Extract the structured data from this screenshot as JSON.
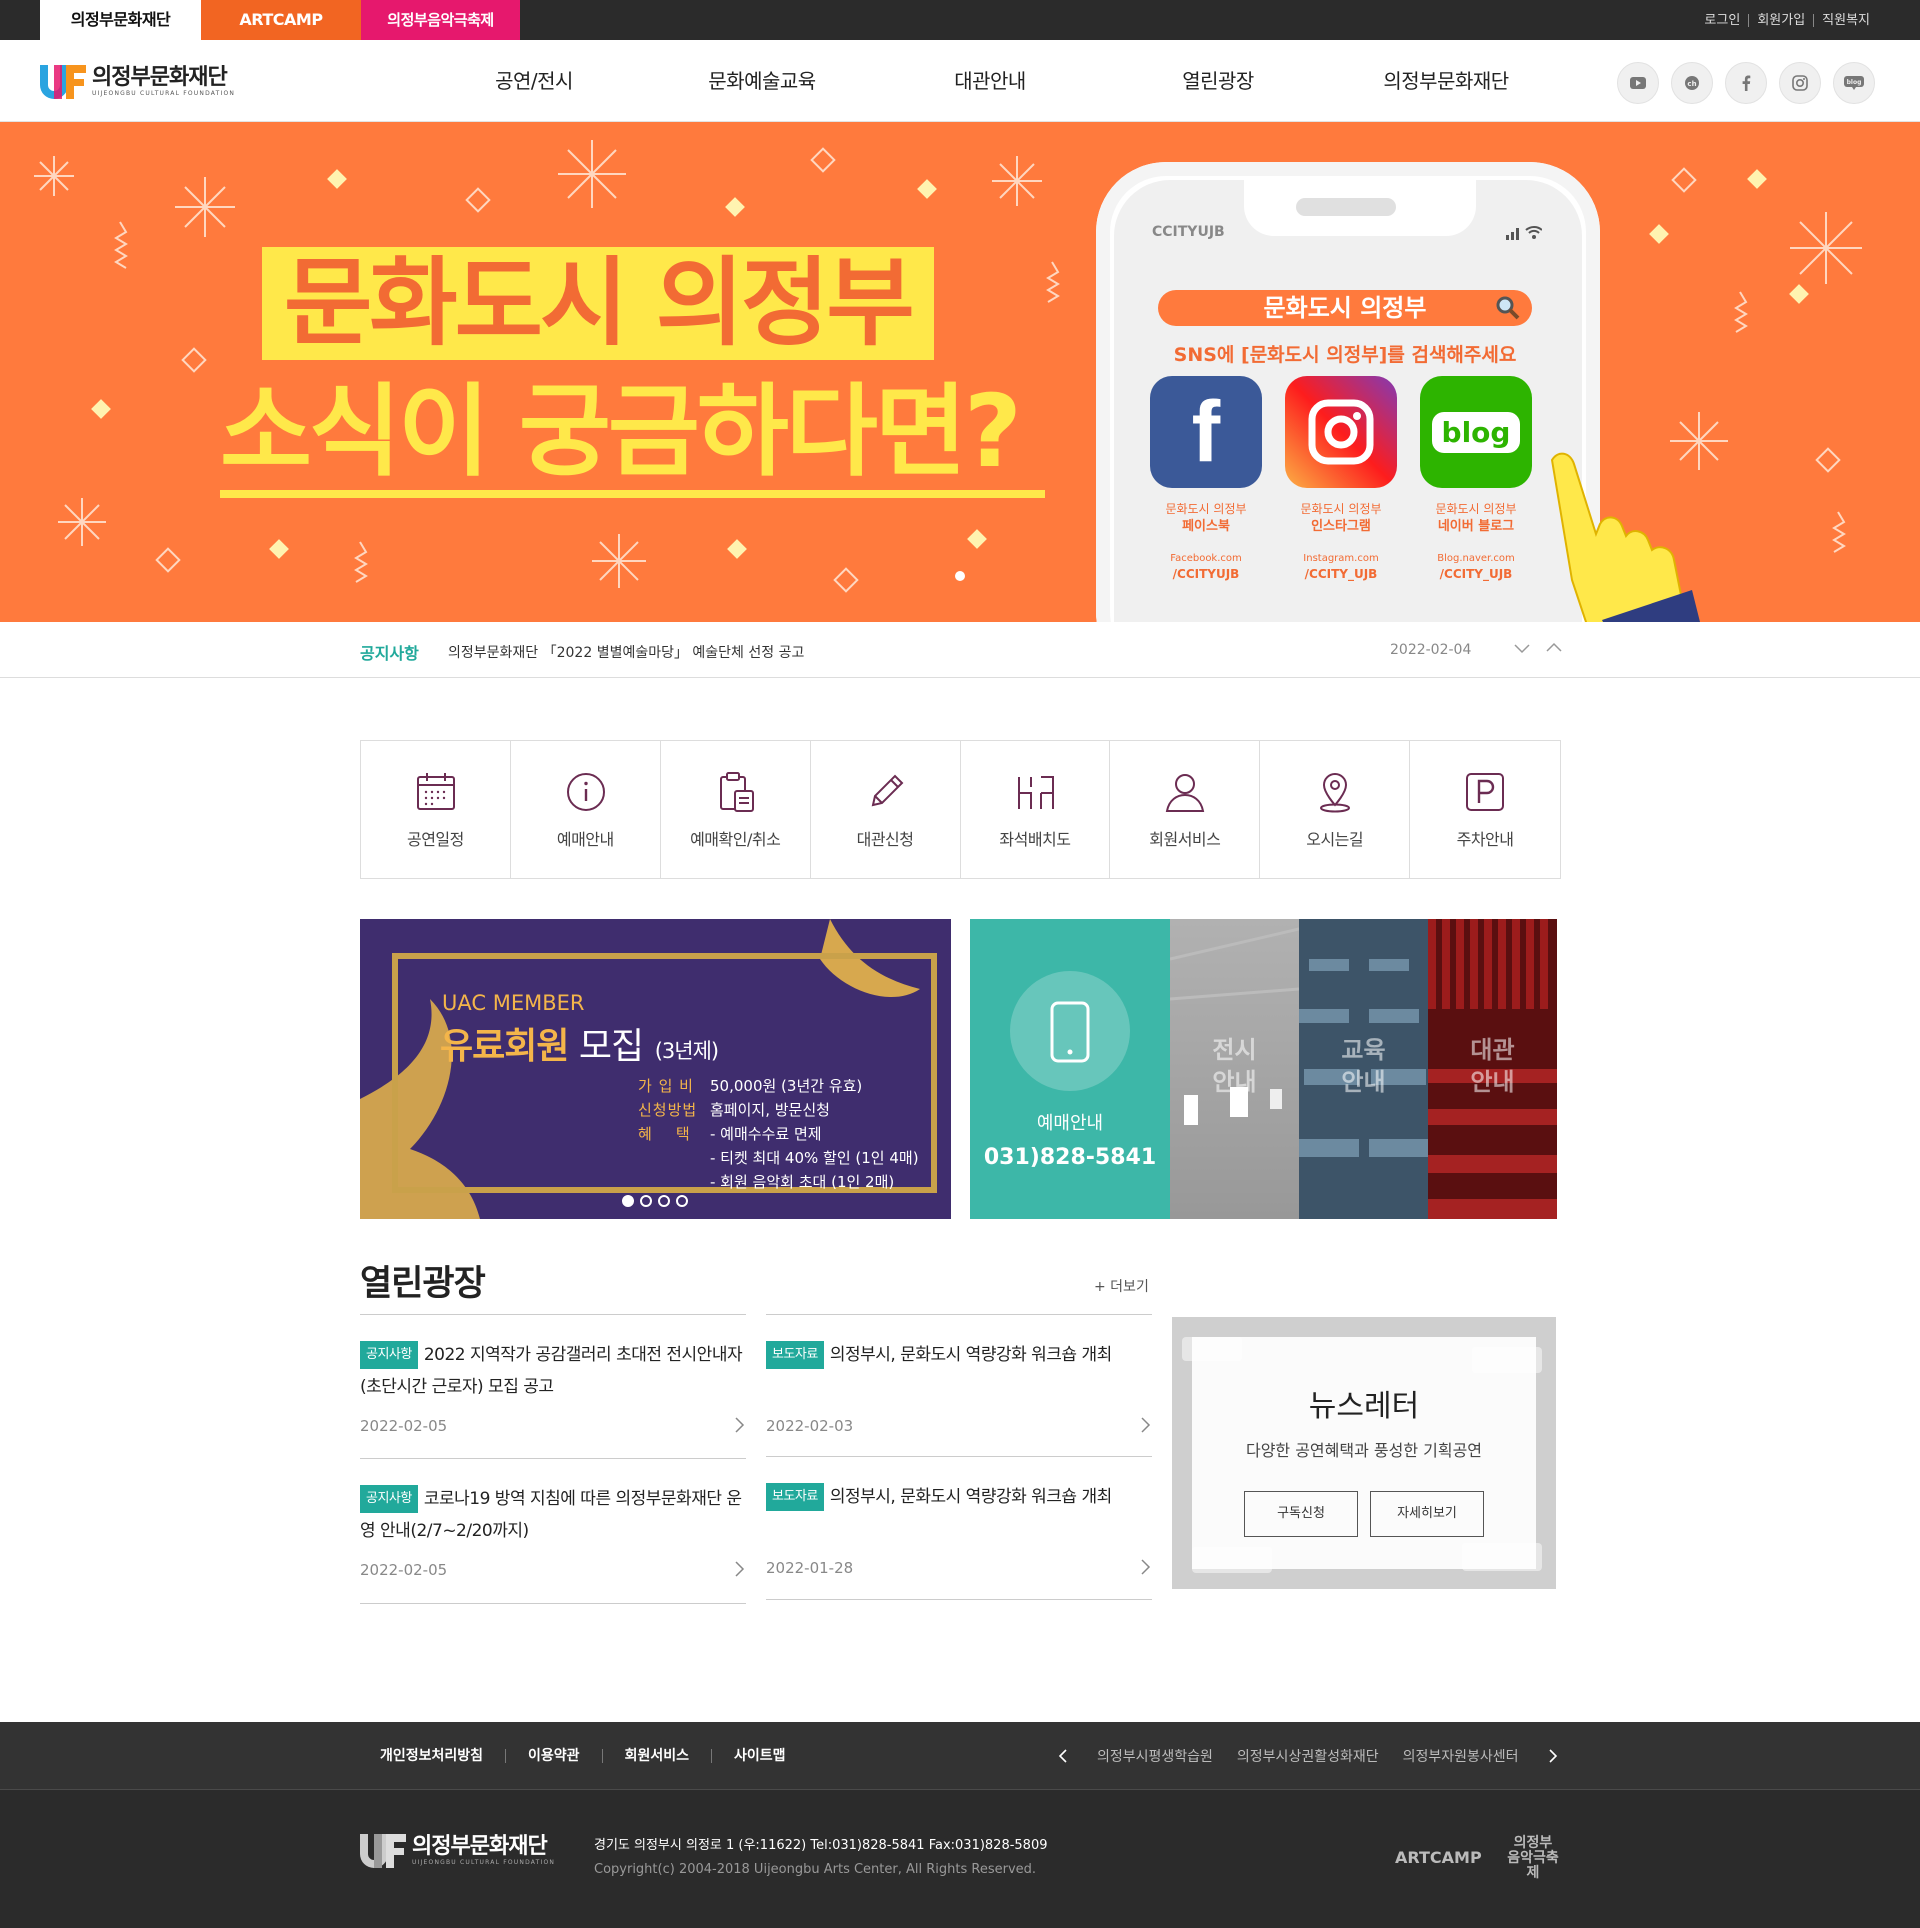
{
  "top_tabs": [
    "의정부문화재단",
    "ARTCAMP",
    "의정부음악극축제"
  ],
  "util_links": [
    "로그인",
    "회원가입",
    "직원복지"
  ],
  "logo": {
    "title": "의정부문화재단",
    "sub": "UIJEONGBU CULTURAL FOUNDATION"
  },
  "gnb": [
    "공연/전시",
    "문화예술교육",
    "대관안내",
    "열린광장",
    "의정부문화재단"
  ],
  "sns_icons": [
    "youtube-icon",
    "kakao-channel-icon",
    "facebook-icon",
    "instagram-icon",
    "blog-icon"
  ],
  "hero": {
    "line1": "문화도시 의정부",
    "line2": "소식이 궁금하다면?",
    "phone_brand": "CCITYUJB",
    "search_text": "문화도시 의정부",
    "hint": "SNS에 [문화도시 의정부]를 검색해주세요",
    "cards": [
      {
        "tile": "f",
        "l1": "문화도시 의정부",
        "l2": "페이스북",
        "l3": "Facebook.com",
        "l4": "/CCITYUJB",
        "color": "#3b5998"
      },
      {
        "tile": "",
        "l1": "문화도시 의정부",
        "l2": "인스타그램",
        "l3": "Instagram.com",
        "l4": "/CCITY_UJB",
        "color": "#e1306c"
      },
      {
        "tile": "blog",
        "l1": "문화도시 의정부",
        "l2": "네이버 블로그",
        "l3": "Blog.naver.com",
        "l4": "/CCITY_UJB",
        "color": "#2db400"
      }
    ]
  },
  "ticker": {
    "label": "공지사항",
    "text": "의정부문화재단 「2022 별별예술마당」 예술단체 선정 공고",
    "date": "2022-02-04"
  },
  "quick_menu": [
    "공연일정",
    "예매안내",
    "예매확인/취소",
    "대관신청",
    "좌석배치도",
    "회원서비스",
    "오시는길",
    "주차안내"
  ],
  "promo": {
    "en": "UAC MEMBER",
    "title_a": "유료회원",
    "title_b": " 모집",
    "title_c": "(3년제)",
    "rows": [
      {
        "k": "가 입 비",
        "v": "50,000원 (3년간 유효)"
      },
      {
        "k": "신청방법",
        "v": "홈페이지, 방문신청"
      },
      {
        "k": "혜    택",
        "v": "- 예매수수료 면제"
      }
    ],
    "extra": [
      "- 티켓 최대 40% 할인 (1인 4매)",
      "- 회원 음악회 초대 (1인 2매)"
    ]
  },
  "booking": {
    "label": "예매안내",
    "phone": "031)828-5841"
  },
  "tiles": [
    {
      "l1": "전시",
      "l2": "안내"
    },
    {
      "l1": "교육",
      "l2": "안내"
    },
    {
      "l1": "대관",
      "l2": "안내"
    }
  ],
  "board": {
    "title": "열린광장",
    "more": "+ 더보기",
    "posts": [
      {
        "badge": "공지사항",
        "title": "2022 지역작가 공감갤러리 초대전 전시안내자(초단시간 근로자) 모집 공고",
        "date": "2022-02-05"
      },
      {
        "badge": "보도자료",
        "title": "의정부시, 문화도시 역량강화 워크숍 개최",
        "date": "2022-02-03"
      },
      {
        "badge": "공지사항",
        "title": "코로나19 방역 지침에 따른 의정부문화재단 운영 안내(2/7~2/20까지)",
        "date": "2022-02-05"
      },
      {
        "badge": "보도자료",
        "title": "의정부시, 문화도시 역량강화 워크숍 개최",
        "date": "2022-01-28"
      }
    ]
  },
  "newsletter": {
    "title": "뉴스레터",
    "sub": "다양한 공연혜택과 풍성한 기획공연",
    "btn1": "구독신청",
    "btn2": "자세히보기"
  },
  "footer": {
    "links": [
      "개인정보처리방침",
      "이용약관",
      "회원서비스",
      "사이트맵"
    ],
    "sites": [
      "의정부시평생학습원",
      "의정부시상권활성화재단",
      "의정부자원봉사센터"
    ],
    "address": "경기도 의정부시 의정로 1 (우:11622) Tel:031)828-5841 Fax:031)828-5809",
    "copyright": "Copyright(c) 2004-2018 Uijeongbu Arts Center, All Rights Reserved.",
    "artcamp": "ARTCAMP",
    "festival": [
      "의정부",
      "음악극축제"
    ]
  },
  "colors": {
    "accent": "#21a99b",
    "hero_bg": "#ff7a3d",
    "hero_yellow": "#ffe84a",
    "promo_bg": "#3f2d6e",
    "booking_bg": "#3db7a8"
  }
}
